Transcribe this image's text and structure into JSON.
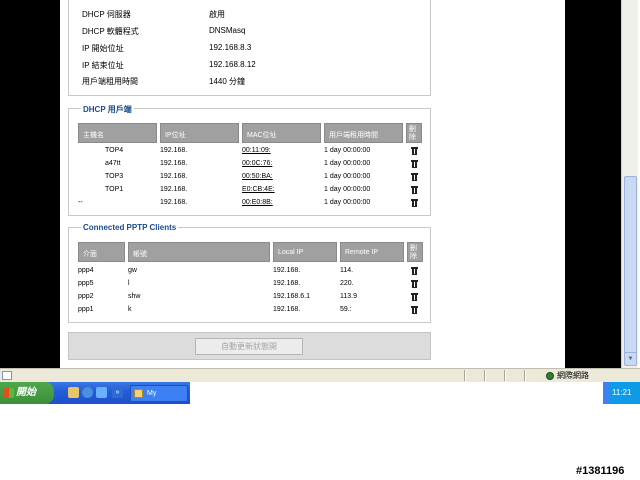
{
  "dhcp_server": {
    "rows": [
      {
        "label": "DHCP 伺服器",
        "value": "啟用"
      },
      {
        "label": "DHCP 軟體程式",
        "value": "DNSMasq"
      },
      {
        "label": "IP 開始位址",
        "value": "192.168.8.3"
      },
      {
        "label": "IP 結束位址",
        "value": "192.168.8.12"
      },
      {
        "label": "用戶端租用時間",
        "value": "1440 分鐘"
      }
    ]
  },
  "dhcp_clients": {
    "legend": "DHCP 用戶端",
    "headers": [
      "主機名",
      "IP位址",
      "MAC位址",
      "用戶端租用時間",
      "刪除"
    ],
    "rows": [
      {
        "host": "TOP4",
        "ip": "192.168.",
        "mac": "00:11:09:",
        "lease": "1 day 00:00:00"
      },
      {
        "host": "a47tt",
        "ip": "192.168.",
        "mac": "00:0C:76:",
        "lease": "1 day 00:00:00"
      },
      {
        "host": "TOP3",
        "ip": "192.168.",
        "mac": "00:50:BA:",
        "lease": "1 day 00:00:00"
      },
      {
        "host": "TOP1",
        "ip": "192.168.",
        "mac": "E0:CB:4E:",
        "lease": "1 day 00:00:00"
      },
      {
        "host": "--",
        "ip": "192.168.",
        "mac": "00:E0:8B:",
        "lease": "1 day 00:00:00"
      }
    ]
  },
  "pptp_clients": {
    "legend": "Connected PPTP Clients",
    "headers": [
      "介面",
      "帳號",
      "Local IP",
      "Remote IP",
      "刪除"
    ],
    "rows": [
      {
        "iface": "ppp4",
        "user": "gw",
        "local": "192.168.",
        "remote": "114."
      },
      {
        "iface": "ppp5",
        "user": "l",
        "local": "192.168.",
        "remote": "220."
      },
      {
        "iface": "ppp2",
        "user": "shw",
        "local": "192.168.6.1",
        "remote": "113.9"
      },
      {
        "iface": "ppp1",
        "user": "k",
        "local": "192.168.",
        "remote": "59.:"
      }
    ]
  },
  "refresh_button": "自動更新狀態開",
  "statusbar": {
    "zone": "網際網路"
  },
  "taskbar": {
    "start": "開始",
    "task_label": "My",
    "clock": "11:21"
  },
  "watermark": "#1381196"
}
